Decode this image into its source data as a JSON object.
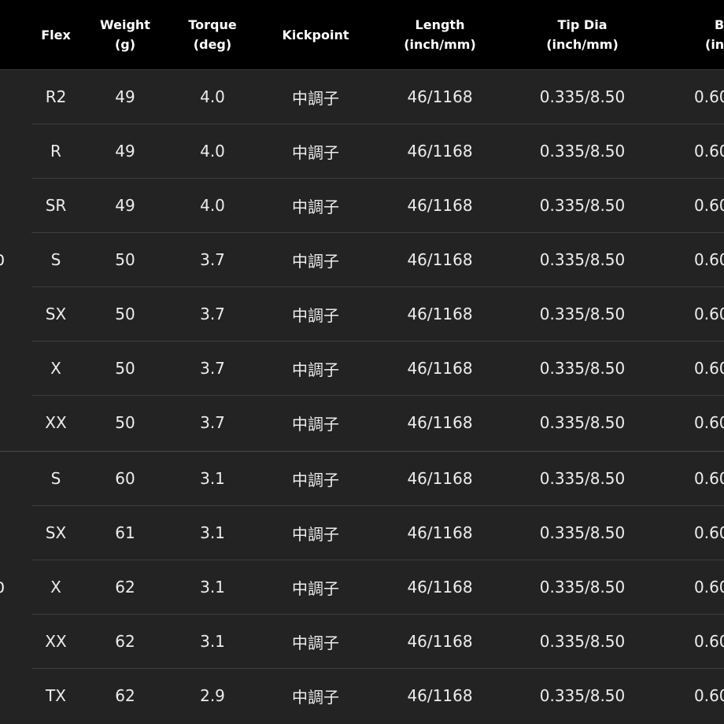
{
  "table": {
    "headers": [
      {
        "line1": "Flex",
        "line2": ""
      },
      {
        "line1": "Weight",
        "line2": "(g)"
      },
      {
        "line1": "Torque",
        "line2": "(deg)"
      },
      {
        "line1": "Kickpoint",
        "line2": ""
      },
      {
        "line1": "Length",
        "line2": "(inch/mm)"
      },
      {
        "line1": "Tip Dia",
        "line2": "(inch/mm)"
      },
      {
        "line1": "B",
        "line2": "(in"
      }
    ],
    "groups": [
      {
        "label": "0"
      },
      {
        "label": "0"
      }
    ],
    "rows": [
      {
        "flex": "R2",
        "weight": "49",
        "torque": "4.0",
        "kickpoint": "中調子",
        "length": "46/1168",
        "tip": "0.335/8.50",
        "butt": "0.60"
      },
      {
        "flex": "R",
        "weight": "49",
        "torque": "4.0",
        "kickpoint": "中調子",
        "length": "46/1168",
        "tip": "0.335/8.50",
        "butt": "0.60"
      },
      {
        "flex": "SR",
        "weight": "49",
        "torque": "4.0",
        "kickpoint": "中調子",
        "length": "46/1168",
        "tip": "0.335/8.50",
        "butt": "0.60"
      },
      {
        "flex": "S",
        "weight": "50",
        "torque": "3.7",
        "kickpoint": "中調子",
        "length": "46/1168",
        "tip": "0.335/8.50",
        "butt": "0.60"
      },
      {
        "flex": "SX",
        "weight": "50",
        "torque": "3.7",
        "kickpoint": "中調子",
        "length": "46/1168",
        "tip": "0.335/8.50",
        "butt": "0.60"
      },
      {
        "flex": "X",
        "weight": "50",
        "torque": "3.7",
        "kickpoint": "中調子",
        "length": "46/1168",
        "tip": "0.335/8.50",
        "butt": "0.60"
      },
      {
        "flex": "XX",
        "weight": "50",
        "torque": "3.7",
        "kickpoint": "中調子",
        "length": "46/1168",
        "tip": "0.335/8.50",
        "butt": "0.60"
      },
      {
        "flex": "S",
        "weight": "60",
        "torque": "3.1",
        "kickpoint": "中調子",
        "length": "46/1168",
        "tip": "0.335/8.50",
        "butt": "0.60"
      },
      {
        "flex": "SX",
        "weight": "61",
        "torque": "3.1",
        "kickpoint": "中調子",
        "length": "46/1168",
        "tip": "0.335/8.50",
        "butt": "0.60"
      },
      {
        "flex": "X",
        "weight": "62",
        "torque": "3.1",
        "kickpoint": "中調子",
        "length": "46/1168",
        "tip": "0.335/8.50",
        "butt": "0.60"
      },
      {
        "flex": "XX",
        "weight": "62",
        "torque": "3.1",
        "kickpoint": "中調子",
        "length": "46/1168",
        "tip": "0.335/8.50",
        "butt": "0.60"
      },
      {
        "flex": "TX",
        "weight": "62",
        "torque": "2.9",
        "kickpoint": "中調子",
        "length": "46/1168",
        "tip": "0.335/8.50",
        "butt": "0.60"
      }
    ]
  }
}
